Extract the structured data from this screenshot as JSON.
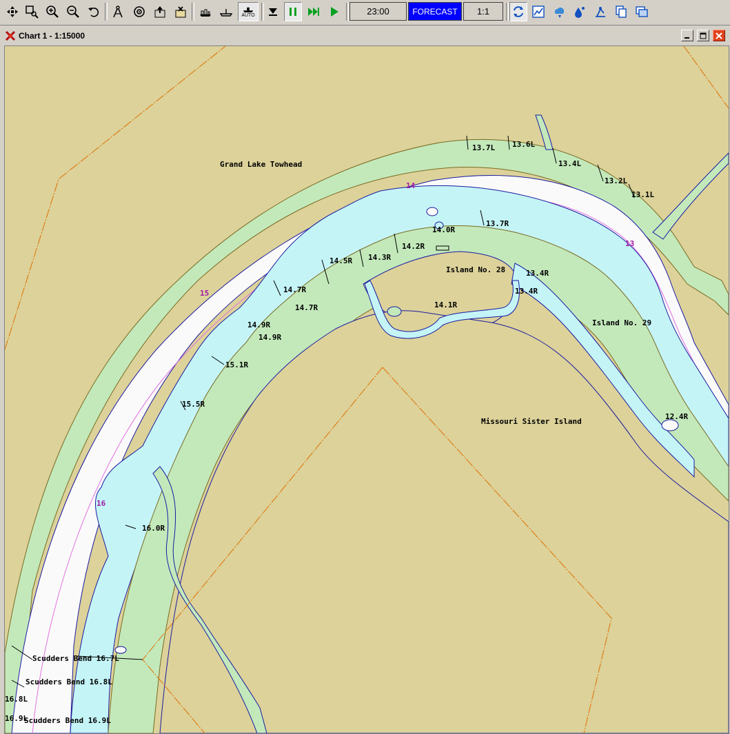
{
  "toolbar": {
    "time": "23:00",
    "forecast": "FORECAST",
    "scale": "1:1",
    "auto": "AUTO"
  },
  "window": {
    "title": "Chart 1 - 1:15000"
  },
  "map": {
    "place_labels": {
      "grand_lake_towhead": "Grand Lake Towhead",
      "island_28": "Island No. 28",
      "island_29": "Island No. 29",
      "missouri_sister": "Missouri Sister Island"
    },
    "mile_markers": {
      "m13": "13",
      "m14": "14",
      "m15": "15",
      "m16": "16"
    },
    "bank_marks": {
      "b13_7L": "13.7L",
      "b13_6L": "13.6L",
      "b13_4L": "13.4L",
      "b13_2L": "13.2L",
      "b13_1L": "13.1L",
      "b14_0R": "14.0R",
      "b13_7R": "13.7R",
      "b14_2R": "14.2R",
      "b14_3R": "14.3R",
      "b14_5R": "14.5R",
      "b13_4R_a": "13.4R",
      "b13_4R_b": "13.4R",
      "b14_7R_a": "14.7R",
      "b14_7R_b": "14.7R",
      "b14_1R": "14.1R",
      "b14_9R_a": "14.9R",
      "b14_9R_b": "14.9R",
      "b15_1R": "15.1R",
      "b15_5R": "15.5R",
      "b12_4R": "12.4R",
      "b16_0R": "16.0R",
      "b16_8L": "16.8L",
      "b16_9L": "16.9L"
    },
    "scudders": {
      "s1": "Scudders Bend 16.7L",
      "s2": "Scudders Bend 16.8L",
      "s3": "Scudders Bend 16.9L"
    }
  },
  "colors": {
    "land": "#dcd29a",
    "green_bar": "#c3e9bb",
    "shallow_water": "#c4f4f6",
    "channel": "#fafafa",
    "mile_marker": "#a01ca8",
    "boundary": "#e07000",
    "shore": "#1a1aa0",
    "forecast_bg": "#0000ff"
  }
}
